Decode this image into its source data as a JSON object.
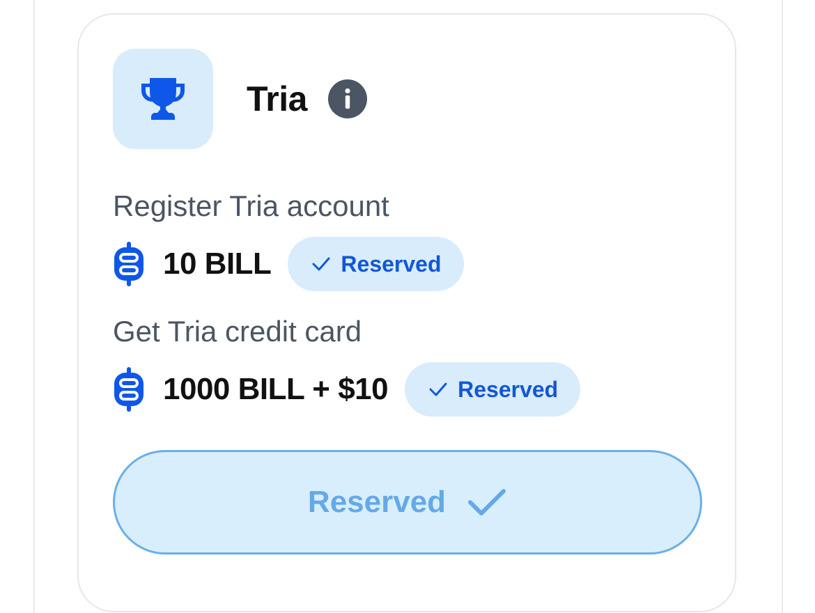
{
  "card": {
    "title": "Tria",
    "trophy_icon": "trophy-icon",
    "info_icon": "info-icon",
    "tasks": [
      {
        "label": "Register Tria account",
        "reward": "10 BILL",
        "status": "Reserved",
        "coin_icon": "bill-coin-icon"
      },
      {
        "label": "Get Tria credit card",
        "reward": "1000 BILL + $10",
        "status": "Reserved",
        "coin_icon": "bill-coin-icon"
      }
    ],
    "action_button": {
      "label": "Reserved",
      "state": "disabled"
    }
  },
  "colors": {
    "accent_blue": "#1257d6",
    "tile_background": "#d8ecfb",
    "button_text": "#64a9e8",
    "button_border": "#6aaeea",
    "label_gray": "#4b5563",
    "info_gray": "#4b5563"
  }
}
